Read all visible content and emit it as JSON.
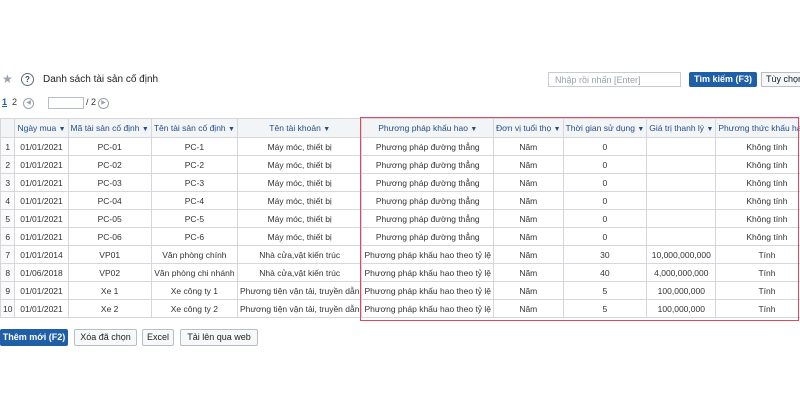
{
  "toolbar": {
    "title": "Danh sách tài sản cố định",
    "search_placeholder": "Nhập rồi nhấn [Enter]",
    "search_button": "Tìm kiếm (F3)",
    "options_button": "Tùy chọn",
    "star_icon": "star-icon",
    "help_icon": "help-icon"
  },
  "pager": {
    "current": "1",
    "next_page": "2",
    "total": "/ 2",
    "prev_icon": "◀",
    "next_icon": "▶"
  },
  "table": {
    "columns": [
      "Ngày mua",
      "Mã tài sản cố định",
      "Tên tài sản cố định",
      "Tên tài khoản",
      "Phương pháp khấu hao",
      "Đơn vị tuổi thọ",
      "Thời gian sử dụng",
      "Giá trị thanh lý",
      "Phương thức khấu hao"
    ],
    "rows": [
      {
        "num": "1",
        "date": "01/01/2021",
        "code": "PC-01",
        "name": "PC-1",
        "account": "Máy móc, thiết bị",
        "method": "Phương pháp đường thẳng",
        "unit": "Năm",
        "period": "0",
        "salvage": "",
        "mode": "Không tính"
      },
      {
        "num": "2",
        "date": "01/01/2021",
        "code": "PC-02",
        "name": "PC-2",
        "account": "Máy móc, thiết bị",
        "method": "Phương pháp đường thẳng",
        "unit": "Năm",
        "period": "0",
        "salvage": "",
        "mode": "Không tính"
      },
      {
        "num": "3",
        "date": "01/01/2021",
        "code": "PC-03",
        "name": "PC-3",
        "account": "Máy móc, thiết bị",
        "method": "Phương pháp đường thẳng",
        "unit": "Năm",
        "period": "0",
        "salvage": "",
        "mode": "Không tính"
      },
      {
        "num": "4",
        "date": "01/01/2021",
        "code": "PC-04",
        "name": "PC-4",
        "account": "Máy móc, thiết bị",
        "method": "Phương pháp đường thẳng",
        "unit": "Năm",
        "period": "0",
        "salvage": "",
        "mode": "Không tính"
      },
      {
        "num": "5",
        "date": "01/01/2021",
        "code": "PC-05",
        "name": "PC-5",
        "account": "Máy móc, thiết bị",
        "method": "Phương pháp đường thẳng",
        "unit": "Năm",
        "period": "0",
        "salvage": "",
        "mode": "Không tính"
      },
      {
        "num": "6",
        "date": "01/01/2021",
        "code": "PC-06",
        "name": "PC-6",
        "account": "Máy móc, thiết bị",
        "method": "Phương pháp đường thẳng",
        "unit": "Năm",
        "period": "0",
        "salvage": "",
        "mode": "Không tính"
      },
      {
        "num": "7",
        "date": "01/01/2014",
        "code": "VP01",
        "name": "Văn phòng chính",
        "account": "Nhà cửa,vật kiến trúc",
        "method": "Phương pháp khấu hao theo tỷ lệ",
        "unit": "Năm",
        "period": "30",
        "salvage": "10,000,000,000",
        "mode": "Tính"
      },
      {
        "num": "8",
        "date": "01/06/2018",
        "code": "VP02",
        "name": "Văn phòng chi nhánh",
        "account": "Nhà cửa,vật kiến trúc",
        "method": "Phương pháp khấu hao theo tỷ lệ",
        "unit": "Năm",
        "period": "40",
        "salvage": "4,000,000,000",
        "mode": "Tính"
      },
      {
        "num": "9",
        "date": "01/01/2021",
        "code": "Xe 1",
        "name": "Xe công ty 1",
        "account": "Phương tiện vận tải, truyền dẫn",
        "method": "Phương pháp khấu hao theo tỷ lệ",
        "unit": "Năm",
        "period": "5",
        "salvage": "100,000,000",
        "mode": "Tính"
      },
      {
        "num": "10",
        "date": "01/01/2021",
        "code": "Xe 2",
        "name": "Xe công ty 2",
        "account": "Phương tiện vận tải, truyền dẫn",
        "method": "Phương pháp khấu hao theo tỷ lệ",
        "unit": "Năm",
        "period": "5",
        "salvage": "100,000,000",
        "mode": "Tính"
      }
    ]
  },
  "actions": {
    "new": "Thêm mới (F2)",
    "delete_selected": "Xóa đã chọn",
    "excel": "Excel",
    "upload_web": "Tải lên qua web"
  },
  "colors": {
    "primary": "#1f5fa8",
    "link": "#2a66b5",
    "highlight_border": "#e0485f"
  }
}
